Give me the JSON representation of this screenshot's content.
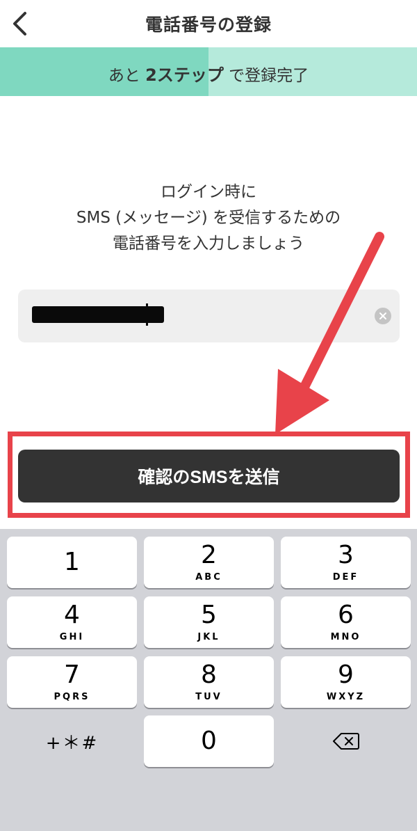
{
  "nav": {
    "title": "電話番号の登録"
  },
  "progress": {
    "prefix": "あと",
    "steps": "2ステップ",
    "suffix": "で登録完了",
    "fraction": 0.5
  },
  "instruction": {
    "lines": [
      "ログイン時に",
      "SMS (メッセージ) を受信するための",
      "電話番号を入力しましょう"
    ]
  },
  "phone_input": {
    "value": ""
  },
  "send_button": {
    "label": "確認のSMSを送信"
  },
  "annotation": {
    "color": "#e8434a"
  },
  "keyboard": {
    "keys": [
      {
        "digit": "1",
        "letters": ""
      },
      {
        "digit": "2",
        "letters": "ABC"
      },
      {
        "digit": "3",
        "letters": "DEF"
      },
      {
        "digit": "4",
        "letters": "GHI"
      },
      {
        "digit": "5",
        "letters": "JKL"
      },
      {
        "digit": "6",
        "letters": "MNO"
      },
      {
        "digit": "7",
        "letters": "PQRS"
      },
      {
        "digit": "8",
        "letters": "TUV"
      },
      {
        "digit": "9",
        "letters": "WXYZ"
      },
      {
        "digit": "+＊#",
        "letters": ""
      },
      {
        "digit": "0",
        "letters": ""
      },
      {
        "digit": "",
        "letters": ""
      }
    ]
  }
}
